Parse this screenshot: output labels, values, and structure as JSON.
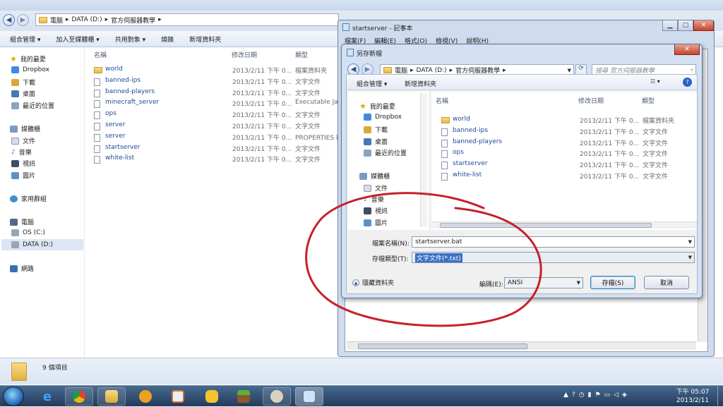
{
  "browser_tabs": [
    "",
    "",
    "",
    ""
  ],
  "explorer": {
    "breadcrumb": [
      "電腦",
      "DATA (D:)",
      "官方伺服器教學"
    ],
    "toolbar": [
      "組合管理 ▾",
      "加入至媒體櫃 ▾",
      "共用對象 ▾",
      "燒錄",
      "新增資料夾"
    ],
    "nav": {
      "favorites": "我的最愛",
      "dropbox": "Dropbox",
      "downloads": "下載",
      "desktop": "桌面",
      "recent": "最近的位置",
      "libraries": "媒體櫃",
      "documents": "文件",
      "music": "音樂",
      "videos": "視訊",
      "pictures": "圖片",
      "homegroup": "家用群組",
      "computer": "電腦",
      "os_c": "OS (C:)",
      "data_d": "DATA (D:)",
      "network": "網路"
    },
    "columns": {
      "name": "名稱",
      "date": "修改日期",
      "type": "類型"
    },
    "files": [
      {
        "name": "world",
        "date": "2013/2/11 下午 0...",
        "type": "檔案資料夾"
      },
      {
        "name": "banned-ips",
        "date": "2013/2/11 下午 0...",
        "type": "文字文件"
      },
      {
        "name": "banned-players",
        "date": "2013/2/11 下午 0...",
        "type": "文字文件"
      },
      {
        "name": "minecraft_server",
        "date": "2013/2/11 下午 0...",
        "type": "Executable Ja"
      },
      {
        "name": "ops",
        "date": "2013/2/11 下午 0...",
        "type": "文字文件"
      },
      {
        "name": "server",
        "date": "2013/2/11 下午 0...",
        "type": "文字文件"
      },
      {
        "name": "server",
        "date": "2013/2/11 下午 0...",
        "type": "PROPERTIES 檔"
      },
      {
        "name": "startserver",
        "date": "2013/2/11 下午 0...",
        "type": "文字文件"
      },
      {
        "name": "white-list",
        "date": "2013/2/11 下午 0...",
        "type": "文字文件"
      }
    ],
    "status": "9 個項目"
  },
  "notepad": {
    "title": "startserver - 記事本",
    "menu": [
      "檔案(F)",
      "編輯(E)",
      "格式(O)",
      "檢視(V)",
      "說明(H)"
    ]
  },
  "dialog": {
    "title": "另存新檔",
    "breadcrumb": [
      "電腦",
      "DATA (D:)",
      "官方伺服器教學"
    ],
    "search_placeholder": "搜尋 官方伺服器教學",
    "toolbar": {
      "organize": "組合管理 ▾",
      "new_folder": "新增資料夾"
    },
    "nav": {
      "favorites": "我的最愛",
      "dropbox": "Dropbox",
      "downloads": "下載",
      "desktop": "桌面",
      "recent": "最近的位置",
      "libraries": "媒體櫃",
      "documents": "文件",
      "music": "音樂",
      "videos": "視訊",
      "pictures": "圖片"
    },
    "columns": {
      "name": "名稱",
      "date": "修改日期",
      "type": "類型"
    },
    "files": [
      {
        "name": "world",
        "date": "2013/2/11 下午 0...",
        "type": "檔案資料夾"
      },
      {
        "name": "banned-ips",
        "date": "2013/2/11 下午 0...",
        "type": "文字文件"
      },
      {
        "name": "banned-players",
        "date": "2013/2/11 下午 0...",
        "type": "文字文件"
      },
      {
        "name": "ops",
        "date": "2013/2/11 下午 0...",
        "type": "文字文件"
      },
      {
        "name": "startserver",
        "date": "2013/2/11 下午 0...",
        "type": "文字文件"
      },
      {
        "name": "white-list",
        "date": "2013/2/11 下午 0...",
        "type": "文字文件"
      }
    ],
    "filename_label": "檔案名稱(N):",
    "filename_value": "startserver.bat",
    "filetype_label": "存檔類型(T):",
    "filetype_value": "文字文件(*.txt)",
    "hide_folders": "隱藏資料夾",
    "encoding_label": "編碼(E):",
    "encoding_value": "ANSI",
    "save": "存檔(S)",
    "cancel": "取消"
  },
  "taskbar": {
    "time": "下午 05:07",
    "date": "2013/2/11"
  },
  "colors": {
    "annotation": "#c8202a",
    "link": "#1c4a9a",
    "taskbar": "#2c4668"
  }
}
